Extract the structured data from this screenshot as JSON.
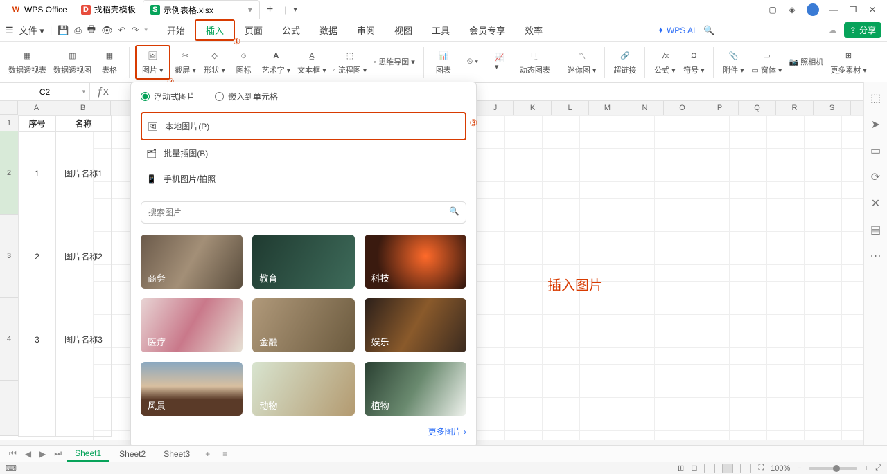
{
  "tabs": {
    "app": "WPS Office",
    "t1": "找稻壳模板",
    "t2": "示例表格.xlsx"
  },
  "menu": {
    "file": "文件",
    "items": [
      "开始",
      "插入",
      "页面",
      "公式",
      "数据",
      "审阅",
      "视图",
      "工具",
      "会员专享",
      "效率"
    ],
    "ai": "WPS AI",
    "share": "分享"
  },
  "ribbon": {
    "r1": "数据透视表",
    "r2": "数据透视图",
    "r3": "表格",
    "r4": "图片",
    "r5": "截屏",
    "r6": "形状",
    "r7": "图标",
    "r8": "艺术字",
    "r9": "文本框",
    "r10": "流程图",
    "r11": "思维导图",
    "r12": "图表",
    "r13": "动态图表",
    "r14": "迷你图",
    "r15": "超链接",
    "r16": "公式",
    "r17": "符号",
    "r18": "附件",
    "r19": "窗体",
    "r20": "照相机",
    "r21": "更多素材"
  },
  "namebox": "C2",
  "colA": "A",
  "colB": "B",
  "colJ": "J",
  "colK": "K",
  "colL": "L",
  "colM": "M",
  "colN": "N",
  "colO": "O",
  "colP": "P",
  "colQ": "Q",
  "colR": "R",
  "colS": "S",
  "row1": "1",
  "row2": "2",
  "row3": "3",
  "row4": "4",
  "cells": {
    "a1": "序号",
    "b1": "名称",
    "a2": "1",
    "b2": "图片名称1",
    "a3": "2",
    "b3": "图片名称2",
    "a4": "3",
    "b4": "图片名称3"
  },
  "drop": {
    "radio1": "浮动式图片",
    "radio2": "嵌入到单元格",
    "opt1": "本地图片(P)",
    "opt2": "批量插图(B)",
    "opt3": "手机图片/拍照",
    "search_ph": "搜索图片",
    "th": [
      "商务",
      "教育",
      "科技",
      "医疗",
      "金融",
      "娱乐",
      "风景",
      "动物",
      "植物"
    ],
    "more": "更多图片"
  },
  "anno": "插入图片",
  "sheets": [
    "Sheet1",
    "Sheet2",
    "Sheet3"
  ],
  "status": {
    "zoom": "100%"
  },
  "badges": {
    "b1": "①",
    "b2": "②",
    "b3": "③"
  }
}
